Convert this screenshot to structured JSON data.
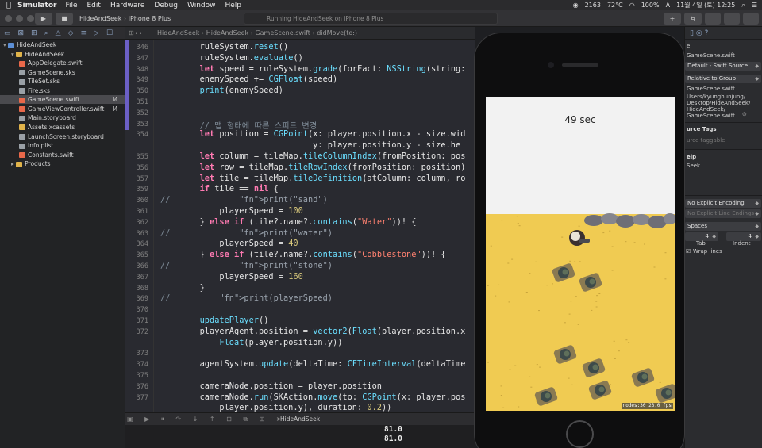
{
  "menubar": {
    "app": "Simulator",
    "items": [
      "File",
      "Edit",
      "Hardware",
      "Debug",
      "Window",
      "Help"
    ],
    "status": {
      "cpu": "2163",
      "temp": "72°C",
      "battery": "100%",
      "user": "A",
      "datetime": "11월 4일 (토) 12:25"
    }
  },
  "toolbar": {
    "scheme": "HideAndSeek",
    "device": "iPhone 8 Plus",
    "status": "Running HideAndSeek on iPhone 8 Plus"
  },
  "navigator": {
    "items": [
      {
        "name": "HideAndSeek",
        "indent": 0,
        "kind": "project"
      },
      {
        "name": "HideAndSeek",
        "indent": 1,
        "kind": "folder"
      },
      {
        "name": "AppDelegate.swift",
        "indent": 2,
        "kind": "swift"
      },
      {
        "name": "GameScene.sks",
        "indent": 2,
        "kind": "file"
      },
      {
        "name": "TileSet.sks",
        "indent": 2,
        "kind": "file"
      },
      {
        "name": "Fire.sks",
        "indent": 2,
        "kind": "file"
      },
      {
        "name": "GameScene.swift",
        "indent": 2,
        "kind": "swift",
        "badge": "M",
        "selected": true
      },
      {
        "name": "GameViewController.swift",
        "indent": 2,
        "kind": "swift",
        "badge": "M"
      },
      {
        "name": "Main.storyboard",
        "indent": 2,
        "kind": "file"
      },
      {
        "name": "Assets.xcassets",
        "indent": 2,
        "kind": "folder"
      },
      {
        "name": "LaunchScreen.storyboard",
        "indent": 2,
        "kind": "file"
      },
      {
        "name": "Info.plist",
        "indent": 2,
        "kind": "file"
      },
      {
        "name": "Constants.swift",
        "indent": 2,
        "kind": "swift"
      },
      {
        "name": "Products",
        "indent": 1,
        "kind": "folder"
      }
    ]
  },
  "jumpbar": {
    "crumbs": [
      "HideAndSeek",
      "HideAndSeek",
      "GameScene.swift",
      "didMove(to:)"
    ]
  },
  "code": {
    "lines": [
      {
        "n": "346",
        "t": "        ruleSystem.reset()"
      },
      {
        "n": "347",
        "t": "        ruleSystem.evaluate()"
      },
      {
        "n": "348",
        "t": "        let speed = ruleSystem.grade(forFact: NSString(string:"
      },
      {
        "n": "349",
        "t": "        enemySpeed += CGFloat(speed)"
      },
      {
        "n": "350",
        "t": "        print(enemySpeed)"
      },
      {
        "n": "351",
        "t": ""
      },
      {
        "n": "352",
        "t": ""
      },
      {
        "n": "353",
        "t": "        // 맵 형태에 따른 스피드 변경"
      },
      {
        "n": "354",
        "t": "        let position = CGPoint(x: player.position.x - size.wid"
      },
      {
        "n": "",
        "t": "                               y: player.position.y - size.he"
      },
      {
        "n": "355",
        "t": "        let column = tileMap.tileColumnIndex(fromPosition: pos"
      },
      {
        "n": "356",
        "t": "        let row = tileMap.tileRowIndex(fromPosition: position)"
      },
      {
        "n": "357",
        "t": "        let tile = tileMap.tileDefinition(atColumn: column, ro"
      },
      {
        "n": "359",
        "t": "        if tile == nil {"
      },
      {
        "n": "360",
        "t": "//              print(\"sand\")"
      },
      {
        "n": "361",
        "t": "            playerSpeed = 100"
      },
      {
        "n": "362",
        "t": "        } else if (tile?.name?.contains(\"Water\"))! {"
      },
      {
        "n": "363",
        "t": "//              print(\"water\")"
      },
      {
        "n": "364",
        "t": "            playerSpeed = 40"
      },
      {
        "n": "365",
        "t": "        } else if (tile?.name?.contains(\"Cobblestone\"))! {"
      },
      {
        "n": "366",
        "t": "//              print(\"stone\")"
      },
      {
        "n": "367",
        "t": "            playerSpeed = 160"
      },
      {
        "n": "368",
        "t": "        }"
      },
      {
        "n": "369",
        "t": "//          print(playerSpeed)"
      },
      {
        "n": "370",
        "t": ""
      },
      {
        "n": "371",
        "t": "        updatePlayer()"
      },
      {
        "n": "372",
        "t": "        playerAgent.position = vector2(Float(player.position.x"
      },
      {
        "n": "",
        "t": "            Float(player.position.y))"
      },
      {
        "n": "373",
        "t": ""
      },
      {
        "n": "374",
        "t": "        agentSystem.update(deltaTime: CFTimeInterval(deltaTime"
      },
      {
        "n": "375",
        "t": ""
      },
      {
        "n": "376",
        "t": "        cameraNode.position = player.position"
      },
      {
        "n": "377",
        "t": "        cameraNode.run(SKAction.move(to: CGPoint(x: player.pos"
      },
      {
        "n": "",
        "t": "            player.position.y), duration: 0.2))"
      }
    ]
  },
  "debug": {
    "target": "HideAndSeek"
  },
  "console": {
    "lines": [
      "81.0",
      "81.0"
    ]
  },
  "simulator": {
    "timer": "49 sec",
    "stats": "nodes:30  23.0 fps"
  },
  "inspector": {
    "filename": "GameScene.swift",
    "file_type": "Default - Swift Source",
    "location": "Relative to Group",
    "path_name": "GameScene.swift",
    "full_path": [
      "Users/kyunghunjung/",
      "Desktop/HideAndSeek/",
      "HideAndSeek/",
      "GameScene.swift"
    ],
    "tags_header": "urce Tags",
    "tags_placeholder": "urce taggable",
    "help_header": "elp",
    "help_item": "Seek",
    "encoding": "No Explicit Encoding",
    "line_endings": "No Explicit Line Endings",
    "indent_using": "Spaces",
    "tab_value": "4",
    "indent_value": "4",
    "tab_label": "Tab",
    "indent_label": "Indent",
    "wrap_lines": "Wrap lines"
  },
  "colors": {
    "sand": "#f0cb52",
    "keyword": "#ff7ab2",
    "function": "#6bdfff",
    "string": "#ff8170",
    "number": "#d9c97c",
    "comment": "#7f8c98"
  }
}
